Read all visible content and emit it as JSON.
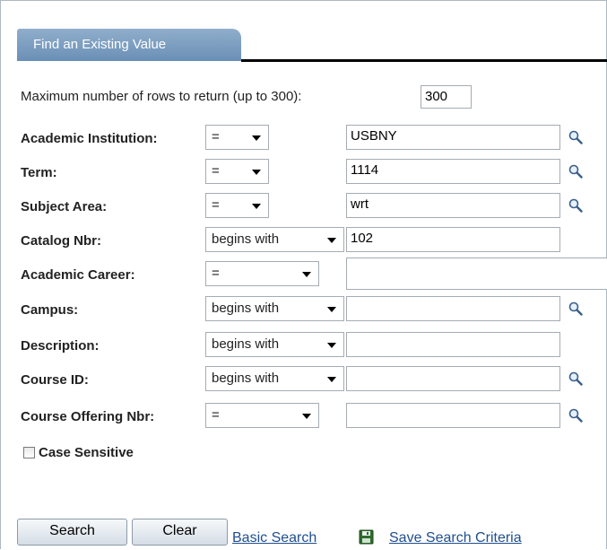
{
  "tab": {
    "label": "Find an Existing Value"
  },
  "max_rows": {
    "label": "Maximum number of rows to return (up to 300):",
    "value": "300"
  },
  "fields": [
    {
      "label": "Academic Institution:",
      "operator": "=",
      "value": "USBNY"
    },
    {
      "label": "Term:",
      "operator": "=",
      "value": "1114"
    },
    {
      "label": "Subject Area:",
      "operator": "=",
      "value": "wrt"
    },
    {
      "label": "Catalog Nbr:",
      "operator": "begins with",
      "value": "102"
    },
    {
      "label": "Academic Career:",
      "operator": "=",
      "value": ""
    },
    {
      "label": "Campus:",
      "operator": "begins with",
      "value": ""
    },
    {
      "label": "Description:",
      "operator": "begins with",
      "value": ""
    },
    {
      "label": "Course ID:",
      "operator": "begins with",
      "value": ""
    },
    {
      "label": "Course Offering Nbr:",
      "operator": "=",
      "value": ""
    }
  ],
  "case_sensitive": {
    "label": "Case Sensitive",
    "checked": false
  },
  "buttons": {
    "search": "Search",
    "clear": "Clear"
  },
  "links": {
    "basic_search": "Basic Search",
    "save_search": "Save Search Criteria"
  },
  "icons": {
    "lookup": "magnifier-icon",
    "save": "floppy-disk-icon"
  },
  "colors": {
    "tab": "#6a8fb5",
    "link": "#1f4f8f"
  }
}
